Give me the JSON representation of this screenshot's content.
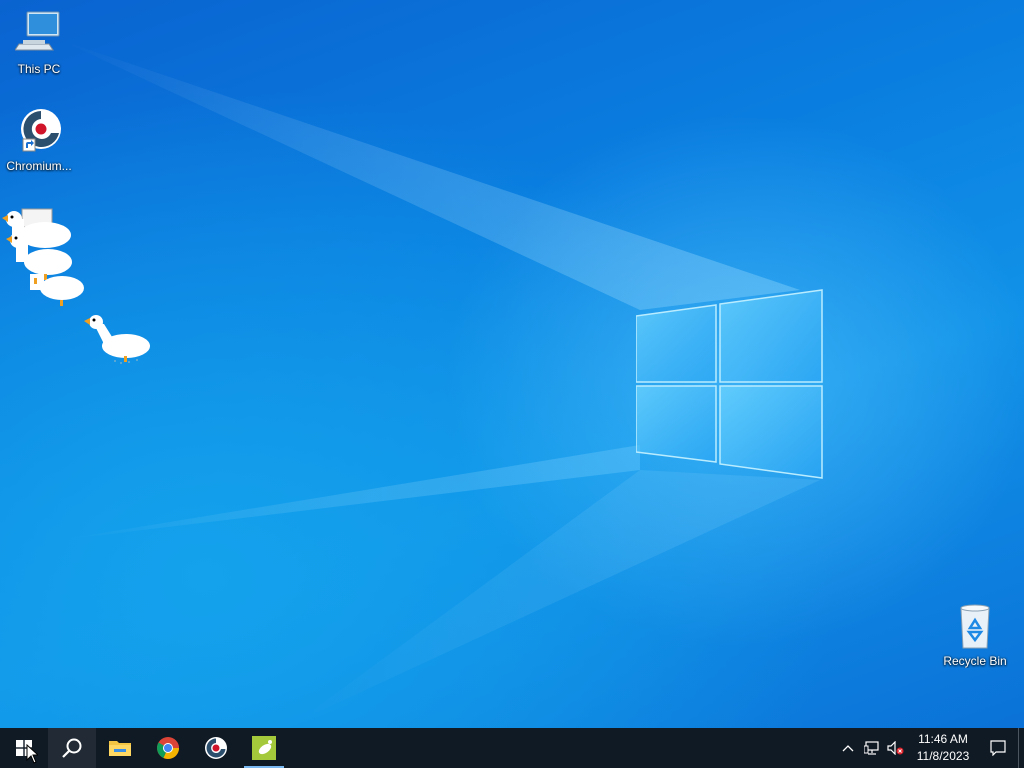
{
  "desktop": {
    "icons": [
      {
        "label": "This PC",
        "icon": "computer-icon"
      },
      {
        "label": "Chromium...",
        "icon": "chromium-shortcut-icon"
      },
      {
        "label": "Recycle Bin",
        "icon": "recycle-bin-icon"
      }
    ],
    "overlay": "desktop-goose-pet"
  },
  "taskbar": {
    "buttons": [
      {
        "name": "start",
        "icon": "windows-start-icon"
      },
      {
        "name": "search",
        "icon": "search-icon"
      },
      {
        "name": "file-explorer",
        "icon": "folder-icon"
      },
      {
        "name": "chrome",
        "icon": "chrome-icon"
      },
      {
        "name": "chromium",
        "icon": "chromium-icon"
      },
      {
        "name": "desktop-goose",
        "icon": "goose-app-icon",
        "running": true
      }
    ],
    "tray": {
      "icons": [
        "chevron-up-icon",
        "network-icon",
        "speaker-muted-icon"
      ],
      "time": "11:46 AM",
      "date": "11/8/2023",
      "notification_icon": "action-center-icon"
    }
  },
  "colors": {
    "taskbar_bg": "#101a24",
    "wallpaper_blue": "#0a7ee0",
    "running_indicator": "#79b8f0"
  }
}
